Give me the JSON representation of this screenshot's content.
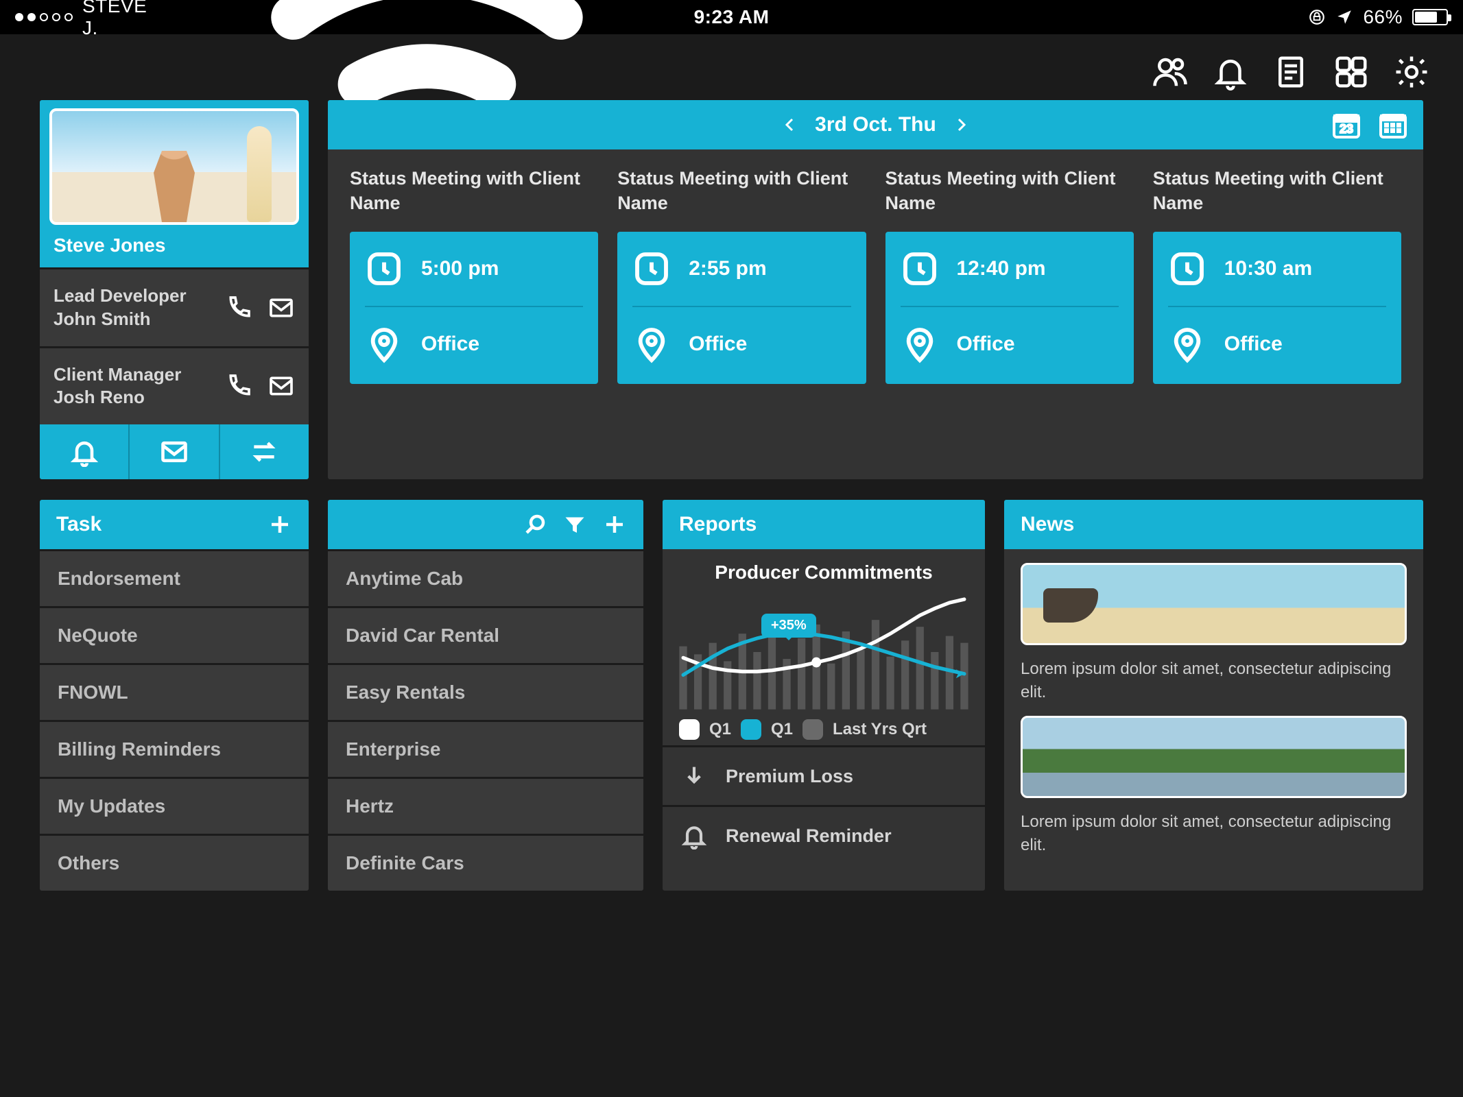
{
  "status_bar": {
    "carrier": "STEVE J.",
    "time": "9:23 AM",
    "battery_pct": "66%"
  },
  "profile": {
    "name": "Steve Jones",
    "contacts": [
      {
        "role": "Lead Developer",
        "name": "John Smith"
      },
      {
        "role": "Client Manager",
        "name": "Josh Reno"
      }
    ]
  },
  "schedule": {
    "date_label": "3rd Oct. Thu",
    "day_badge": "23",
    "meetings": [
      {
        "title": "Status Meeting with Client Name",
        "time": "5:00 pm",
        "location": "Office"
      },
      {
        "title": "Status Meeting with Client Name",
        "time": "2:55 pm",
        "location": "Office"
      },
      {
        "title": "Status Meeting with Client Name",
        "time": "12:40 pm",
        "location": "Office"
      },
      {
        "title": "Status Meeting with Client Name",
        "time": "10:30 am",
        "location": "Office"
      }
    ]
  },
  "tasks": {
    "title": "Task",
    "items": [
      "Endorsement",
      "NeQuote",
      "FNOWL",
      "Billing Reminders",
      "My Updates",
      "Others"
    ]
  },
  "clients": {
    "items": [
      "Anytime Cab",
      "David Car Rental",
      "Easy Rentals",
      "Enterprise",
      "Hertz",
      "Definite Cars"
    ]
  },
  "reports": {
    "title": "Reports",
    "chart_title": "Producer Commitments",
    "badge": "+35%",
    "legend": [
      {
        "label": "Q1",
        "color": "#ffffff"
      },
      {
        "label": "Q1",
        "color": "#17b2d4"
      },
      {
        "label": "Last Yrs Qrt",
        "color": "#6a6a6a"
      }
    ],
    "rows": [
      {
        "icon": "arrow-down",
        "label": "Premium Loss"
      },
      {
        "icon": "bell",
        "label": "Renewal Reminder"
      }
    ]
  },
  "news": {
    "title": "News",
    "items": [
      "Lorem ipsum dolor sit amet, consectetur adipiscing elit.",
      "Lorem ipsum dolor sit amet, consectetur adipiscing elit."
    ]
  },
  "chart_data": {
    "type": "line",
    "title": "Producer Commitments",
    "annotation": "+35%",
    "x": [
      0,
      1,
      2,
      3,
      4,
      5,
      6,
      7,
      8,
      9,
      10,
      11,
      12,
      13,
      14,
      15,
      16,
      17,
      18,
      19
    ],
    "series": [
      {
        "name": "Q1 (white)",
        "color": "#ffffff",
        "values": [
          45,
          40,
          36,
          34,
          33,
          33,
          34,
          36,
          38,
          41,
          44,
          48,
          53,
          59,
          66,
          74,
          82,
          88,
          93,
          96
        ]
      },
      {
        "name": "Q1 (cyan)",
        "color": "#17b2d4",
        "values": [
          30,
          38,
          46,
          53,
          58,
          62,
          65,
          66,
          66,
          65,
          63,
          60,
          57,
          53,
          49,
          45,
          41,
          37,
          34,
          31
        ]
      },
      {
        "name": "Last Yrs Qrt bars",
        "color": "#6a6a6a",
        "values": [
          55,
          48,
          58,
          42,
          66,
          50,
          70,
          44,
          62,
          74,
          40,
          68,
          52,
          78,
          46,
          60,
          72,
          50,
          64,
          58
        ]
      }
    ],
    "ylim": [
      0,
      100
    ]
  }
}
